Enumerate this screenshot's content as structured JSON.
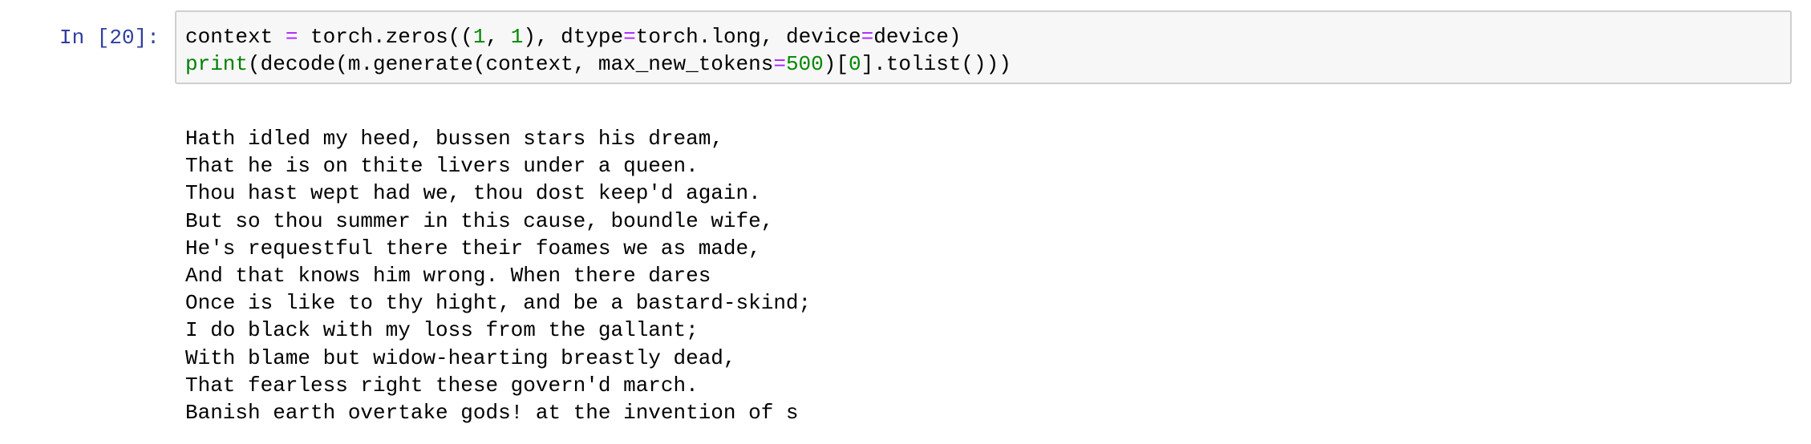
{
  "cell": {
    "prompt": "In [20]:",
    "code": {
      "line1": {
        "a": "context ",
        "op1": "=",
        "b": " torch.zeros((",
        "n1": "1",
        "c": ", ",
        "n2": "1",
        "d": "), dtype",
        "op2": "=",
        "e": "torch.long, device",
        "op3": "=",
        "f": "device)"
      },
      "line2": {
        "fn": "print",
        "a": "(decode(m.generate(context, max_new_tokens",
        "op1": "=",
        "n1": "500",
        "b": ")[",
        "n2": "0",
        "c": "].tolist()))"
      }
    },
    "output": {
      "lines": [
        "Hath idled my heed, bussen stars his dream,",
        "That he is on thite livers under a queen.",
        "Thou hast wept had we, thou dost keep'd again.",
        "But so thou summer in this cause, boundle wife,",
        "He's requestful there their foames we as made,",
        "And that knows him wrong. When there dares",
        "Once is like to thy hight, and be a bastard-skind;",
        "I do black with my loss from the gallant;",
        "With blame but widow-hearting breastly dead,",
        "That fearless right these govern'd march.",
        "Banish earth overtake gods! at the invention of s"
      ]
    }
  },
  "colors": {
    "prompt": "#303f9f",
    "operator": "#aa22ff",
    "number": "#008800",
    "builtin": "#008000",
    "input_background": "#f7f7f7",
    "input_border": "#cfcfcf"
  }
}
